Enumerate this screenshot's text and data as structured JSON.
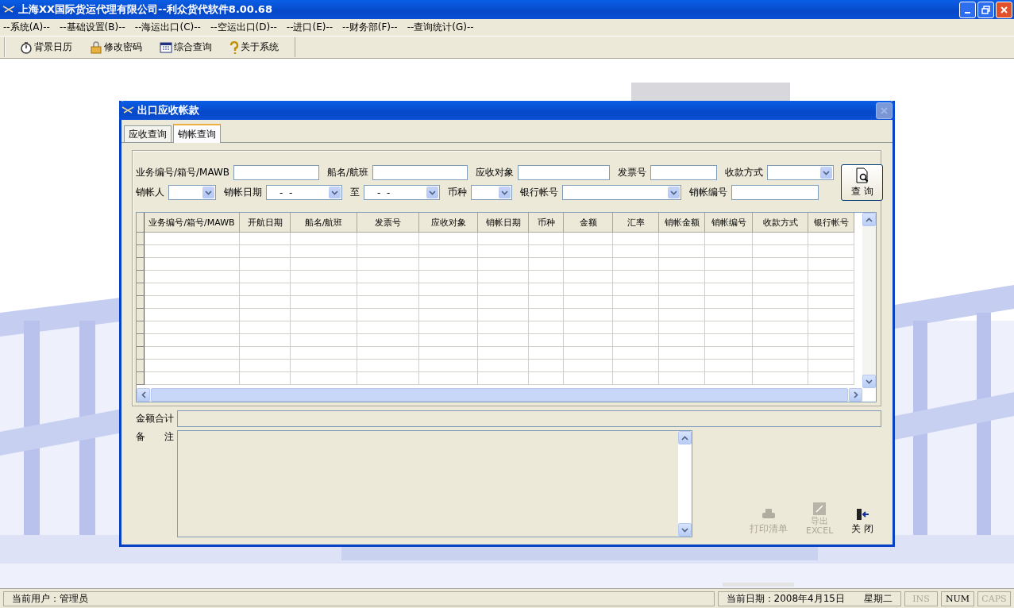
{
  "window": {
    "title": "上海XX国际货运代理有限公司--利众货代软件8.00.68"
  },
  "menu": [
    {
      "label": "--系统(A)--"
    },
    {
      "label": "--基础设置(B)--"
    },
    {
      "label": "--海运出口(C)--"
    },
    {
      "label": "--空运出口(D)--"
    },
    {
      "label": "--进口(E)--"
    },
    {
      "label": "--财务部(F)--"
    },
    {
      "label": "--查询统计(G)--"
    }
  ],
  "toolbar": [
    {
      "label": "背景日历",
      "kind": "clock"
    },
    {
      "label": "修改密码",
      "kind": "lock"
    },
    {
      "label": "综合查询",
      "kind": "calendar"
    },
    {
      "label": "关于系统",
      "kind": "help"
    }
  ],
  "dialog": {
    "title": "出口应收帐款",
    "tabs": [
      {
        "label": "应收查询",
        "selected": false
      },
      {
        "label": "销帐查询",
        "selected": true
      }
    ],
    "filters": [
      [
        {
          "label": "业务编号/箱号/MAWB",
          "kind": "text"
        },
        {
          "label": "船名/航班",
          "kind": "text"
        },
        {
          "label": "应收对象",
          "kind": "text"
        },
        {
          "label": "发票号",
          "kind": "text"
        },
        {
          "label": "收款方式",
          "kind": "select"
        }
      ],
      [
        {
          "label": "销帐人",
          "kind": "select"
        },
        {
          "label": "销帐日期",
          "kind": "date",
          "value": "-  -"
        },
        {
          "label": "至",
          "kind": "date",
          "value": "-  -"
        },
        {
          "label": "币种",
          "kind": "select"
        },
        {
          "label": "银行帐号",
          "kind": "select"
        },
        {
          "label": "销帐编号",
          "kind": "text"
        }
      ]
    ],
    "search_button": "查 询",
    "table": {
      "columns": [
        "业务编号/箱号/MAWB",
        "开航日期",
        "船名/航班",
        "发票号",
        "应收对象",
        "销帐日期",
        "币种",
        "金额",
        "汇率",
        "销帐金额",
        "销帐编号",
        "收款方式",
        "银行帐号"
      ]
    },
    "total_label": "金额合计",
    "remark_label": "备　　注",
    "buttons": [
      {
        "label": "打印清单",
        "kind": "print",
        "disabled": true
      },
      {
        "label": "导出EXCEL",
        "kind": "excel",
        "disabled": true
      },
      {
        "label": "关 闭",
        "kind": "exit",
        "disabled": false
      }
    ]
  },
  "status_bar": {
    "user": "当前用户：管理员",
    "date": "当前日期：2008年4月15日",
    "weekday": "星期二",
    "indicators": [
      {
        "label": "INS",
        "on": false
      },
      {
        "label": "NUM",
        "on": true
      },
      {
        "label": "CAPS",
        "on": false
      }
    ]
  }
}
